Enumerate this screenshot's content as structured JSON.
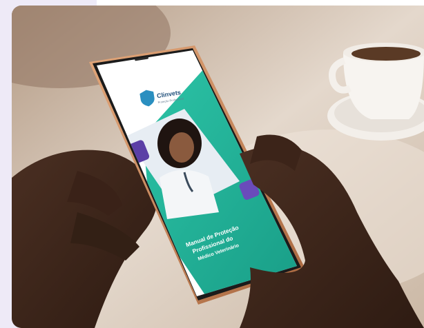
{
  "screen": {
    "logo_text": "Clinvets",
    "logo_subtitle": "Proteção Profissional",
    "title_line_1": "Manual de Proteção",
    "title_line_2": "Profissional do",
    "title_line_3": "Médico Veterinário"
  },
  "colors": {
    "accent_teal": "#1fb59a",
    "accent_purple": "#5b3fa6",
    "backing_lavender": "#eeeaf7",
    "phone_frame": "#c8875a"
  },
  "icons": {
    "logo": "shield-logo-icon"
  }
}
